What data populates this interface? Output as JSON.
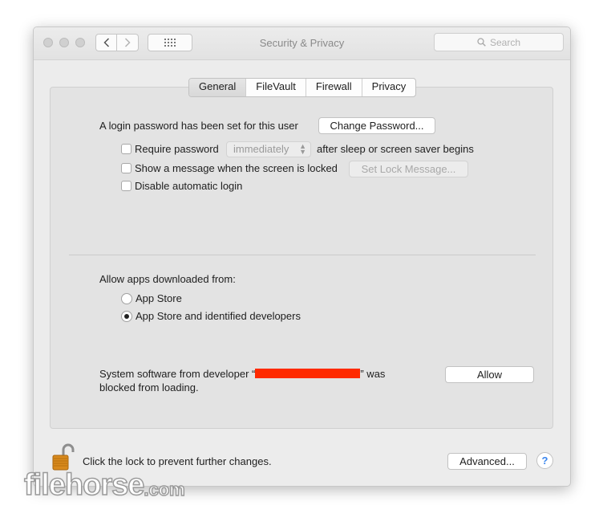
{
  "window": {
    "title": "Security & Privacy"
  },
  "search": {
    "placeholder": "Search"
  },
  "tabs": [
    {
      "label": "General",
      "active": true
    },
    {
      "label": "FileVault",
      "active": false
    },
    {
      "label": "Firewall",
      "active": false
    },
    {
      "label": "Privacy",
      "active": false
    }
  ],
  "general": {
    "login_text": "A login password has been set for this user",
    "change_password_label": "Change Password...",
    "require_password_label": "Require password",
    "require_password_checked": false,
    "require_password_delay": "immediately",
    "after_sleep_text": "after sleep or screen saver begins",
    "show_message_label": "Show a message when the screen is locked",
    "show_message_checked": false,
    "set_lock_message_label": "Set Lock Message...",
    "disable_auto_login_label": "Disable automatic login",
    "disable_auto_login_checked": false
  },
  "apps": {
    "heading": "Allow apps downloaded from:",
    "options": [
      {
        "label": "App Store",
        "selected": false
      },
      {
        "label": "App Store and identified developers",
        "selected": true
      }
    ]
  },
  "blocked": {
    "text_before": "System software from developer “",
    "text_after": "” was",
    "text_line2": "blocked from loading.",
    "allow_label": "Allow",
    "redaction_color": "#ff2a00"
  },
  "footer": {
    "lock_text": "Click the lock to prevent further changes.",
    "advanced_label": "Advanced...",
    "help_label": "?"
  },
  "watermark": {
    "main": "filehorse",
    "domain": ".com"
  },
  "icons": [
    "chevron-left-icon",
    "chevron-right-icon",
    "grid-icon",
    "search-icon",
    "lock-icon",
    "help-icon"
  ]
}
